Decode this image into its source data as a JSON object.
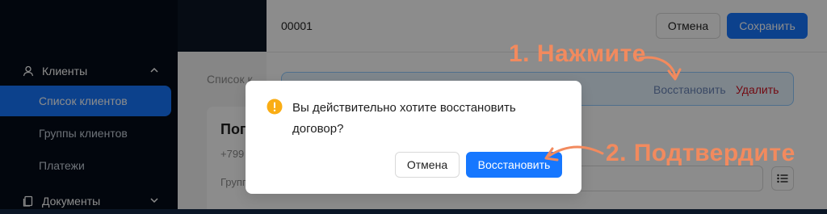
{
  "sidebar": {
    "clients_group": "Клиенты",
    "items": [
      {
        "label": "Список клиентов",
        "active": true
      },
      {
        "label": "Группы клиентов",
        "active": false
      },
      {
        "label": "Платежи",
        "active": false
      }
    ],
    "documents_group": "Документы",
    "user_icon": "user-icon",
    "doc_icon": "document-icon"
  },
  "background": {
    "breadcrumb": "Список к",
    "card_title": "Пог",
    "card_phone": "+799",
    "card_group": "Групп"
  },
  "drawer": {
    "title": "00001",
    "cancel_label": "Отмена",
    "save_label": "Сохранить",
    "restore_link": "Восстановить",
    "delete_link": "Удалить"
  },
  "modal": {
    "message": "Вы действительно хотите восстановить договор?",
    "cancel_label": "Отмена",
    "confirm_label": "Восстановить",
    "icon": "exclamation-circle-icon"
  },
  "annotations": {
    "step1": "1. Нажмите",
    "step2": "2. Подтвердите"
  },
  "colors": {
    "primary": "#1677ff",
    "danger": "#cf1322",
    "warning": "#faad14",
    "annotation": "#f28a5e"
  }
}
